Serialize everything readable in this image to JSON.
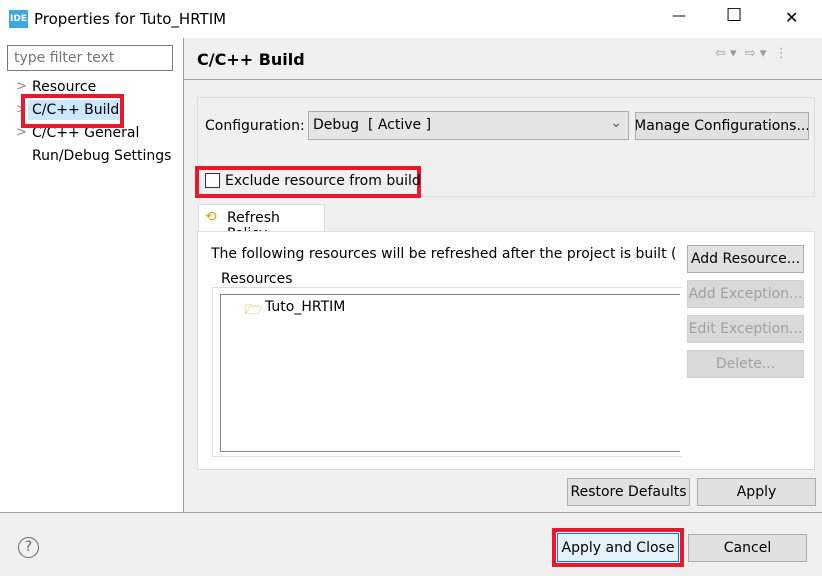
{
  "window": {
    "title": "Properties for Tuto_HRTIM",
    "icon_text": "IDE",
    "minimize": "—",
    "maximize": "☐",
    "close": "✕"
  },
  "sidebar": {
    "filter_placeholder": "type filter text",
    "items": [
      {
        "label": "Resource",
        "expandable": true
      },
      {
        "label": "C/C++ Build",
        "expandable": true,
        "selected": true
      },
      {
        "label": "C/C++ General",
        "expandable": true
      },
      {
        "label": "Run/Debug Settings",
        "expandable": false
      }
    ]
  },
  "page": {
    "title": "C/C++ Build",
    "config_label": "Configuration:",
    "config_value": "Debug  [ Active ]",
    "manage_button": "Manage Configurations...",
    "exclude_label": "Exclude resource from build",
    "exclude_checked": false,
    "tab_label": "Refresh Policy",
    "description": "The following resources will be refreshed after the project is built (exte",
    "resources_label": "Resources",
    "resources": [
      "Tuto_HRTIM"
    ],
    "buttons": {
      "add_resource": "Add Resource...",
      "add_exception": "Add Exception...",
      "edit_exception": "Edit Exception...",
      "delete": "Delete..."
    },
    "restore_defaults": "Restore Defaults",
    "apply": "Apply"
  },
  "footer": {
    "help": "?",
    "apply_close": "Apply and Close",
    "cancel": "Cancel"
  },
  "colors": {
    "highlight": "#e8192c",
    "selection": "#cce8ff"
  }
}
